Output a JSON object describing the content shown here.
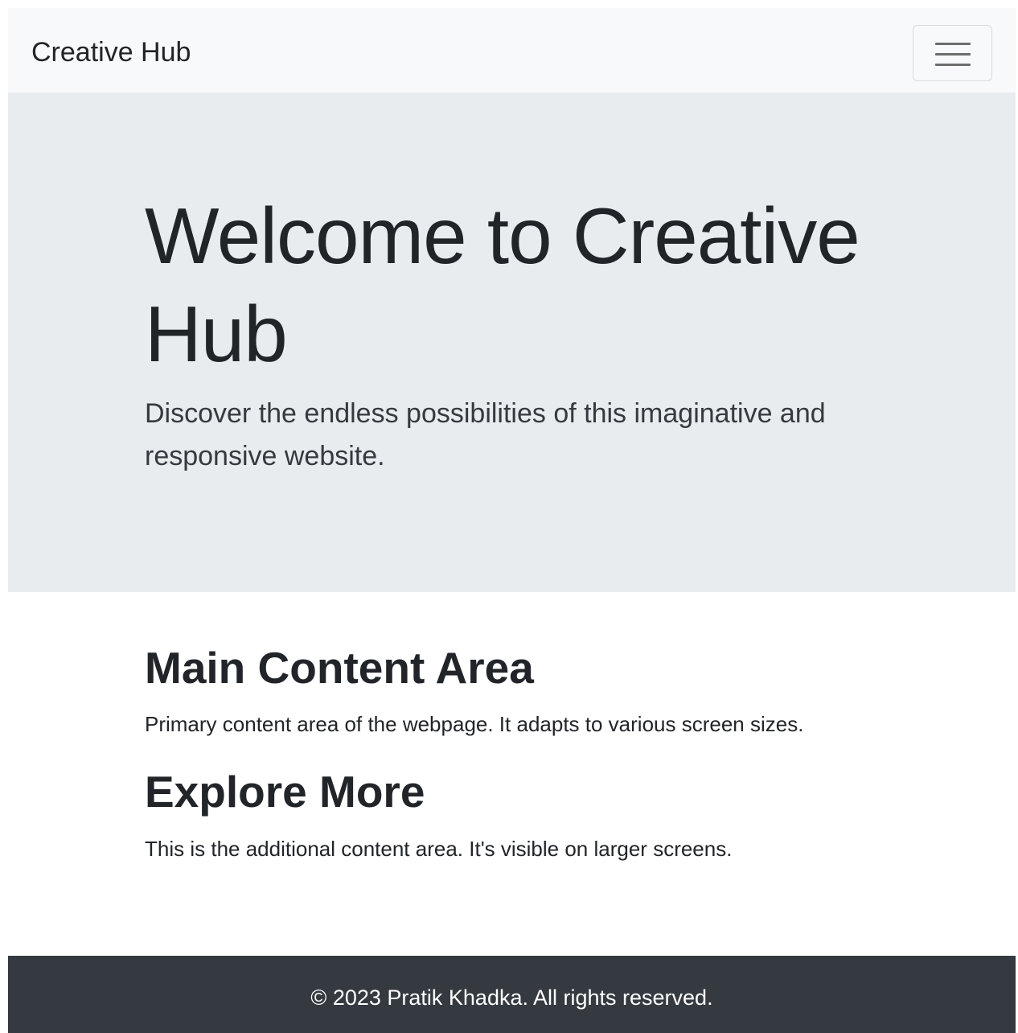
{
  "navbar": {
    "brand": "Creative Hub",
    "toggler_icon": "hamburger-menu-icon"
  },
  "hero": {
    "title": "Welcome to Creative Hub",
    "lead": "Discover the endless possibilities of this imaginative and responsive website."
  },
  "main": {
    "heading": "Main Content Area",
    "text": "Primary content area of the webpage. It adapts to various screen sizes."
  },
  "explore": {
    "heading": "Explore More",
    "text": "This is the additional content area. It's visible on larger screens."
  },
  "footer": {
    "text": "© 2023 Pratik Khadka. All rights reserved."
  },
  "colors": {
    "navbar_bg": "#f8f9fa",
    "hero_bg": "#e9ecef",
    "footer_bg": "#343a40",
    "text": "#212529"
  }
}
